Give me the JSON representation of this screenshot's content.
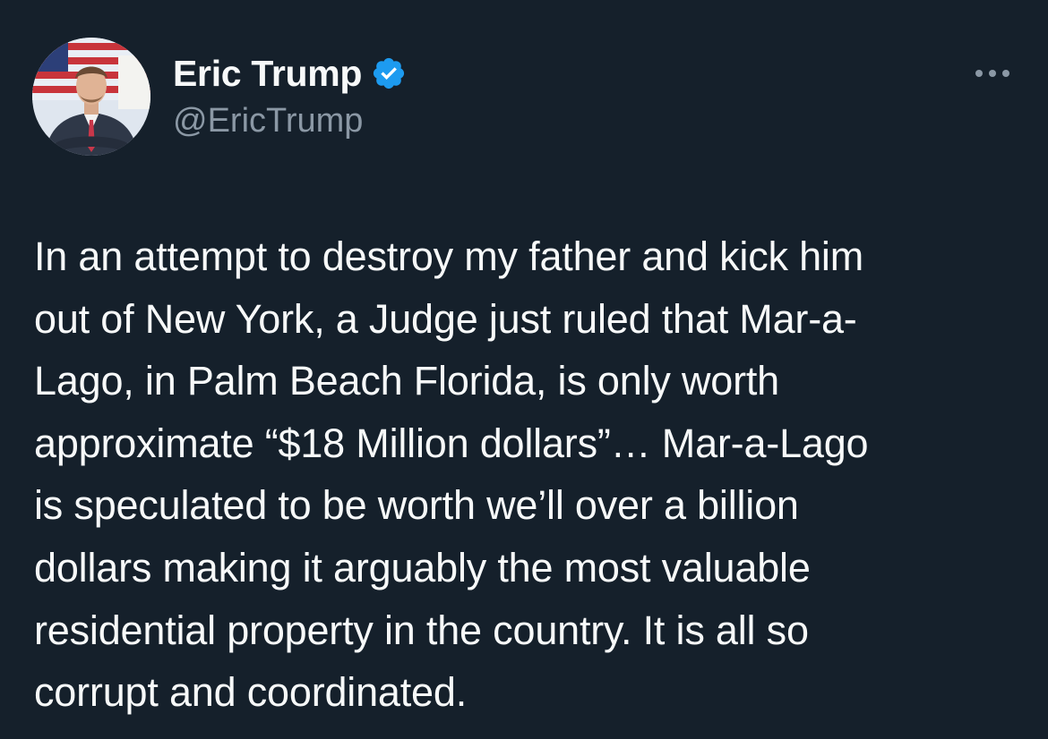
{
  "tweet": {
    "author": {
      "display_name": "Eric Trump",
      "handle": "@EricTrump",
      "verified": true,
      "avatar_icon": "profile-photo"
    },
    "more_icon": "ellipsis-icon",
    "text": "In an attempt to destroy my father and kick him\nout of New York, a Judge just ruled that Mar-a-\nLago, in Palm Beach Florida, is only worth\napproximate “$18 Million dollars”… Mar-a-Lago\nis speculated to be worth we’ll over a billion\ndollars making it arguably the most valuable\nresidential property in the country. It is all so\ncorrupt and coordinated."
  },
  "colors": {
    "background": "#15202b",
    "primary_text": "#f7f9f9",
    "secondary_text": "#8b98a5",
    "verified_badge": "#1d9bf0"
  }
}
